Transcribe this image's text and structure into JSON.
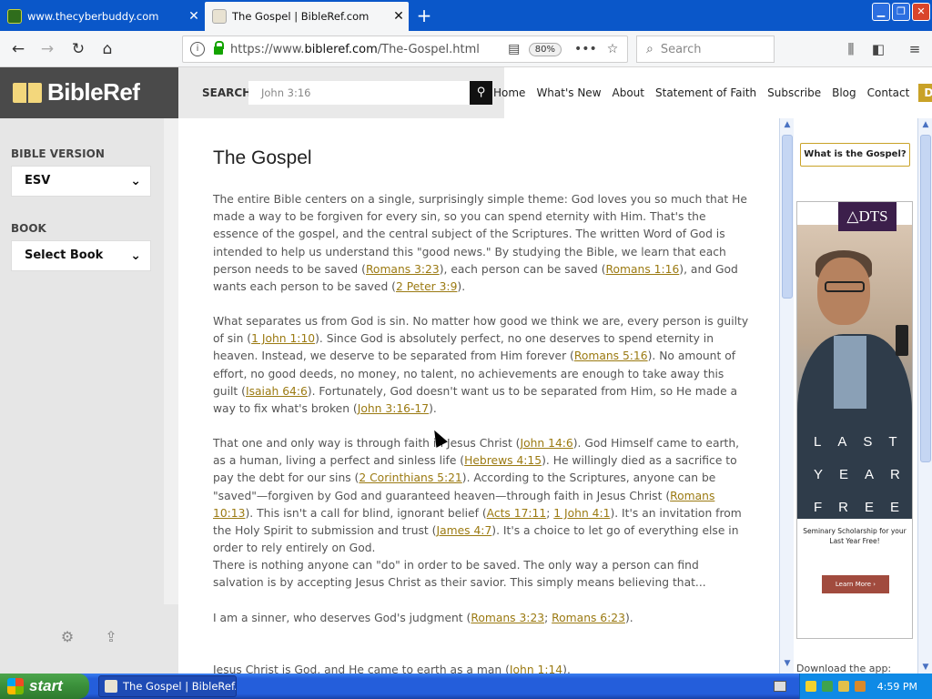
{
  "browser": {
    "tabs": [
      {
        "title": "www.thecyberbuddy.com",
        "active": false
      },
      {
        "title": "The Gospel | BibleRef.com",
        "active": true
      }
    ],
    "url_prefix": "https://www.",
    "url_domain": "bibleref.com",
    "url_path": "/The-Gospel.html",
    "zoom": "80%",
    "search_placeholder": "Search"
  },
  "site": {
    "logo": "BibleRef",
    "search_label": "SEARCH",
    "search_placeholder": "John 3:16",
    "nav": [
      "Home",
      "What's New",
      "About",
      "Statement of Faith",
      "Subscribe",
      "Blog",
      "Contact"
    ],
    "donate": "Donate"
  },
  "sidebar": {
    "version_label": "BIBLE VERSION",
    "version_value": "ESV",
    "book_label": "BOOK",
    "book_value": "Select Book"
  },
  "article": {
    "title": "The Gospel",
    "p1": {
      "t1": "The entire Bible centers on a single, surprisingly simple theme: God loves you so much that He made a way to be forgiven for every sin, so you can spend eternity with Him. That's the essence of the gospel, and the central subject of the Scriptures. The written Word of God is intended to help us understand this \"good news.\" By studying the Bible, we learn that each person needs to be saved (",
      "l1": "Romans 3:23",
      "t2": "), each person can be saved (",
      "l2": "Romans 1:16",
      "t3": "), and God wants each person to be saved (",
      "l3": "2 Peter 3:9",
      "t4": ")."
    },
    "p2": {
      "t1": "What separates us from God is sin. No matter how good we think we are, every person is guilty of sin (",
      "l1": "1 John 1:10",
      "t2": "). Since God is absolutely perfect, no one deserves to spend eternity in heaven. Instead, we deserve to be separated from Him forever (",
      "l2": "Romans 5:16",
      "t3": "). No amount of effort, no good deeds, no money, no talent, no achievements are enough to take away this guilt (",
      "l3": "Isaiah 64:6",
      "t4": "). Fortunately, God doesn't want us to be separated from Him, so He made a way to fix what's broken (",
      "l4": "John 3:16-17",
      "t5": ")."
    },
    "p3": {
      "t1": "That one and only way is through faith in Jesus Christ (",
      "l1": "John 14:6",
      "t2": "). God Himself came to earth, as a human, living a perfect and sinless life (",
      "l2": "Hebrews 4:15",
      "t3": "). He willingly died as a sacrifice to pay the debt for our sins (",
      "l3": "2 Corinthians 5:21",
      "t4": "). According to the Scriptures, anyone can be \"saved\"—forgiven by God and guaranteed heaven—through faith in Jesus Christ (",
      "l4": "Romans 10:13",
      "t5": "). This isn't a call for blind, ignorant belief (",
      "l5": "Acts 17:11",
      "t6": "; ",
      "l6": "1 John 4:1",
      "t7": "). It's an invitation from the Holy Spirit to submission and trust (",
      "l7": "James 4:7",
      "t8": "). It's a choice to let go of everything else in order to rely entirely on God."
    },
    "p4": "There is nothing anyone can \"do\" in order to be saved. The only way a person can find salvation is by accepting Jesus Christ as their savior. This simply means believing that...",
    "p5": {
      "t1": "I am a sinner, who deserves God's judgment (",
      "l1": "Romans 3:23",
      "t2": "; ",
      "l2": "Romans 6:23",
      "t3": ")."
    },
    "p6": {
      "t1": "Jesus Christ is God, and He came to earth as a man (",
      "l1": "John 1:14",
      "t2": ")."
    }
  },
  "ad": {
    "gospel_button": "What is the Gospel?",
    "logo": "△DTS",
    "words": [
      "LAST",
      "YEAR",
      "FREE"
    ],
    "text": "Seminary Scholarship for your Last Year Free!",
    "button": "Learn More ›",
    "footer": "Download the app:"
  },
  "taskbar": {
    "start": "start",
    "window": "The Gospel | BibleRef...",
    "clock": "4:59 PM"
  }
}
